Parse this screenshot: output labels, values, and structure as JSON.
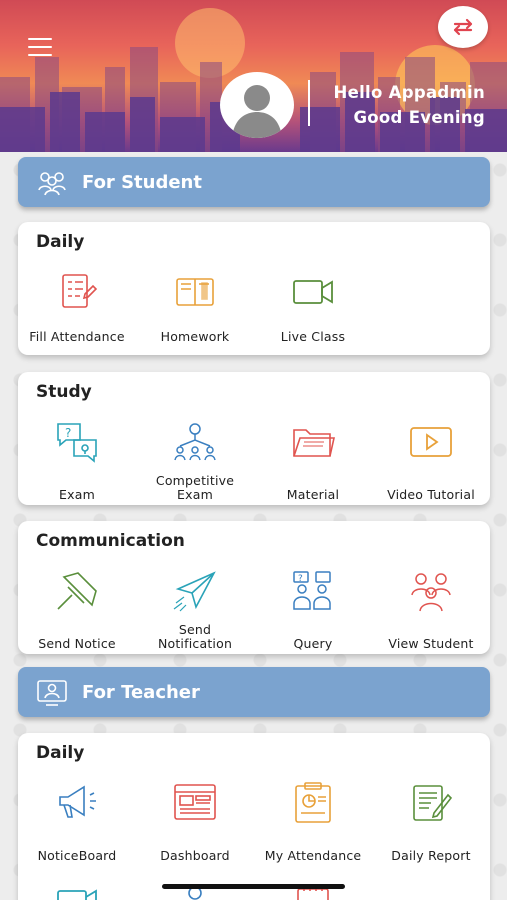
{
  "header": {
    "greeting_line1": "Hello Appadmin",
    "greeting_line2": "Good Evening"
  },
  "student": {
    "banner_title": "For Student",
    "daily": {
      "title": "Daily",
      "items": [
        {
          "label": "Fill Attendance",
          "icon": "attendance-form-icon"
        },
        {
          "label": "Homework",
          "icon": "book-icon"
        },
        {
          "label": "Live Class",
          "icon": "video-camera-icon"
        }
      ]
    },
    "study": {
      "title": "Study",
      "items": [
        {
          "label": "Exam",
          "icon": "exam-chat-icon"
        },
        {
          "label1": "Competitive",
          "label2": "Exam",
          "icon": "competition-icon"
        },
        {
          "label": "Material",
          "icon": "folder-icon"
        },
        {
          "label": "Video Tutorial",
          "icon": "play-video-icon"
        }
      ]
    },
    "communication": {
      "title": "Communication",
      "items": [
        {
          "label": "Send Notice",
          "icon": "pushpin-icon"
        },
        {
          "label1": "Send",
          "label2": "Notification",
          "icon": "paper-plane-icon"
        },
        {
          "label": "Query",
          "icon": "query-people-icon"
        },
        {
          "label": "View Student",
          "icon": "students-group-icon"
        }
      ]
    }
  },
  "teacher": {
    "banner_title": "For Teacher",
    "daily": {
      "title": "Daily",
      "items": [
        {
          "label": "NoticeBoard",
          "icon": "megaphone-icon"
        },
        {
          "label": "Dashboard",
          "icon": "dashboard-icon"
        },
        {
          "label": "My Attendance",
          "icon": "attendance-report-icon"
        },
        {
          "label": "Daily Report",
          "icon": "report-pen-icon"
        }
      ]
    }
  },
  "colors": {
    "banner": "#7ba3cf",
    "icon_red": "#e0544f",
    "icon_orange": "#e8a13a",
    "icon_green": "#5a8f3c",
    "icon_blue": "#3a7fc0",
    "icon_teal": "#2aa3b8"
  }
}
